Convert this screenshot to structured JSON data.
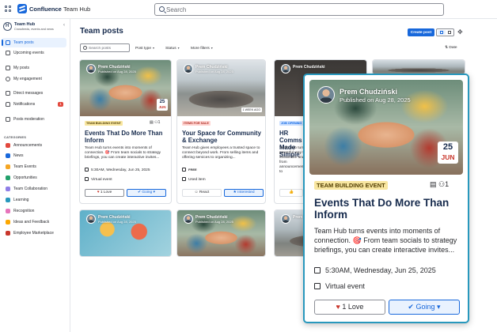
{
  "app": {
    "brand": "Confluence",
    "space": "Team Hub",
    "search_placeholder": "Search"
  },
  "sidebar": {
    "title": "Team Hub",
    "subtitle": "Crossfeeds, events and news",
    "nav": [
      {
        "label": "Team posts",
        "active": true
      },
      {
        "label": "Upcoming events",
        "active": false
      },
      {
        "label": "My posts",
        "active": false
      },
      {
        "label": "My engagement",
        "active": false
      },
      {
        "label": "Direct messages",
        "active": false
      },
      {
        "label": "Notifications",
        "active": false,
        "badge": "1"
      },
      {
        "label": "Posts moderation",
        "active": false
      }
    ],
    "categories_heading": "CATEGORIES",
    "categories": [
      {
        "label": "Announcements",
        "color": "#e2483d"
      },
      {
        "label": "News",
        "color": "#1868db"
      },
      {
        "label": "Team Events",
        "color": "#f5a623"
      },
      {
        "label": "Opportunities",
        "color": "#22a06b"
      },
      {
        "label": "Team Collaboration",
        "color": "#8f7ee7"
      },
      {
        "label": "Learning",
        "color": "#2898bd"
      },
      {
        "label": "Recognition",
        "color": "#e774bb"
      },
      {
        "label": "Ideas and Feedback",
        "color": "#fca700"
      },
      {
        "label": "Employee Marketplace",
        "color": "#c9372c"
      }
    ]
  },
  "main": {
    "title": "Team posts",
    "create_label": "Create post",
    "filter_placeholder": "Search posts",
    "filters": [
      "Post type",
      "Status",
      "More filters"
    ],
    "sort_label": "Date"
  },
  "cards": [
    {
      "author": "Prem Chudziński",
      "published": "Published on Aug 28, 2025",
      "date_day": "25",
      "date_month": "JUN",
      "tag": "TEAM BUILDING EVENT",
      "participants": "1",
      "title": "Events That Do More Than Inform",
      "desc": "Team Hub turns events into moments of connection. 🎯 From team socials to strategy briefings, you can create interactive invites...",
      "time": "5:30AM, Wednesday, Jun 25, 2025",
      "location": "Virtual event",
      "btn1": "1 Love",
      "btn2": "Going"
    },
    {
      "author": "Prem Chudziński",
      "published": "Published on Aug 28, 2025",
      "week_label": "1 WEEK AGO",
      "tag": "ITEMS FOR SALE",
      "title": "Your Space for Community & Exchange",
      "desc": "Team Hub gives employees a trusted space to connect beyond work. From selling items and offering services to organizing...",
      "price": "FREE",
      "condition": "Used item",
      "btn1": "React",
      "btn2": "Interested"
    },
    {
      "author": "Prem Chudziński",
      "tag": "JOB OPENING",
      "title": "HR Comms Made Simple",
      "desc": "Team Hub turns powerful way to streamline and from announcements to"
    },
    {
      "author": "Prem Chudziński",
      "published": "Published on Aug 28, 2025"
    },
    {
      "author": "Prem Chudziński",
      "published": "Published on Aug 28, 2025"
    },
    {
      "author": "Prem Chudziński"
    }
  ],
  "zoom": {
    "author": "Prem Chudziński",
    "published": "Published on Aug 28, 2025",
    "date_day": "25",
    "date_month": "JUN",
    "tag": "TEAM BUILDING EVENT",
    "participants": "1",
    "title": "Events That Do More Than Inform",
    "desc": "Team Hub turns events into moments of connection. 🎯 From team socials to strategy briefings, you can create interactive invites...",
    "time": "5:30AM, Wednesday, Jun 25, 2025",
    "location": "Virtual event",
    "btn1": "1 Love",
    "btn2": "Going"
  }
}
